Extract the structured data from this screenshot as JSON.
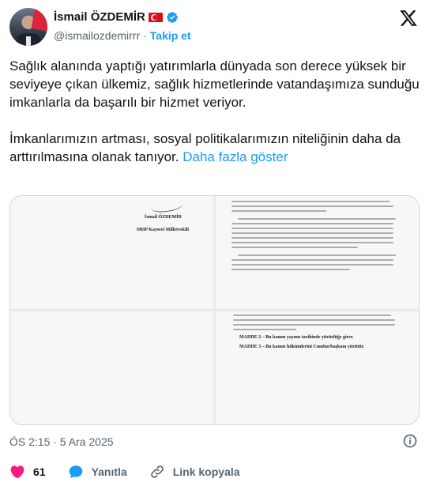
{
  "author": {
    "name": "İsmail ÖZDEMİR",
    "handle": "@ismailozdemirrr",
    "separator": "·",
    "follow_label": "Takip et"
  },
  "tweet": {
    "paragraph1": "Sağlık alanında yaptığı yatırımlarla dünyada son derece yüksek bir seviyeye çıkan ülkemiz, sağlık hizmetlerinde vatandaşımıza sunduğu imkanlarla da başarılı bir hizmet veriyor.",
    "paragraph2": "İmkanlarımızın artması, sosyal politikalarımızın niteliğinin daha da arttırılmasına olanak tanıyor.",
    "show_more": "Daha fazla göster"
  },
  "media": {
    "doc_name": "İsmail ÖZDEMİR",
    "doc_title": "MHP Kayseri Milletvekili",
    "madde2": "MADDE 2 – Bu kanun yayımı tarihinde yürürlüğe girer.",
    "madde3": "MADDE 3 – Bu kanun hükümlerini Cumhurbaşkanı yürütür."
  },
  "meta": {
    "timestamp": "ÖS 2:15 · 5 Ara 2025"
  },
  "actions": {
    "likes": "61",
    "reply_label": "Yanıtla",
    "copy_link_label": "Link kopyala"
  },
  "colors": {
    "accent": "#1d9bf0",
    "like": "#f91880",
    "muted": "#536471"
  }
}
